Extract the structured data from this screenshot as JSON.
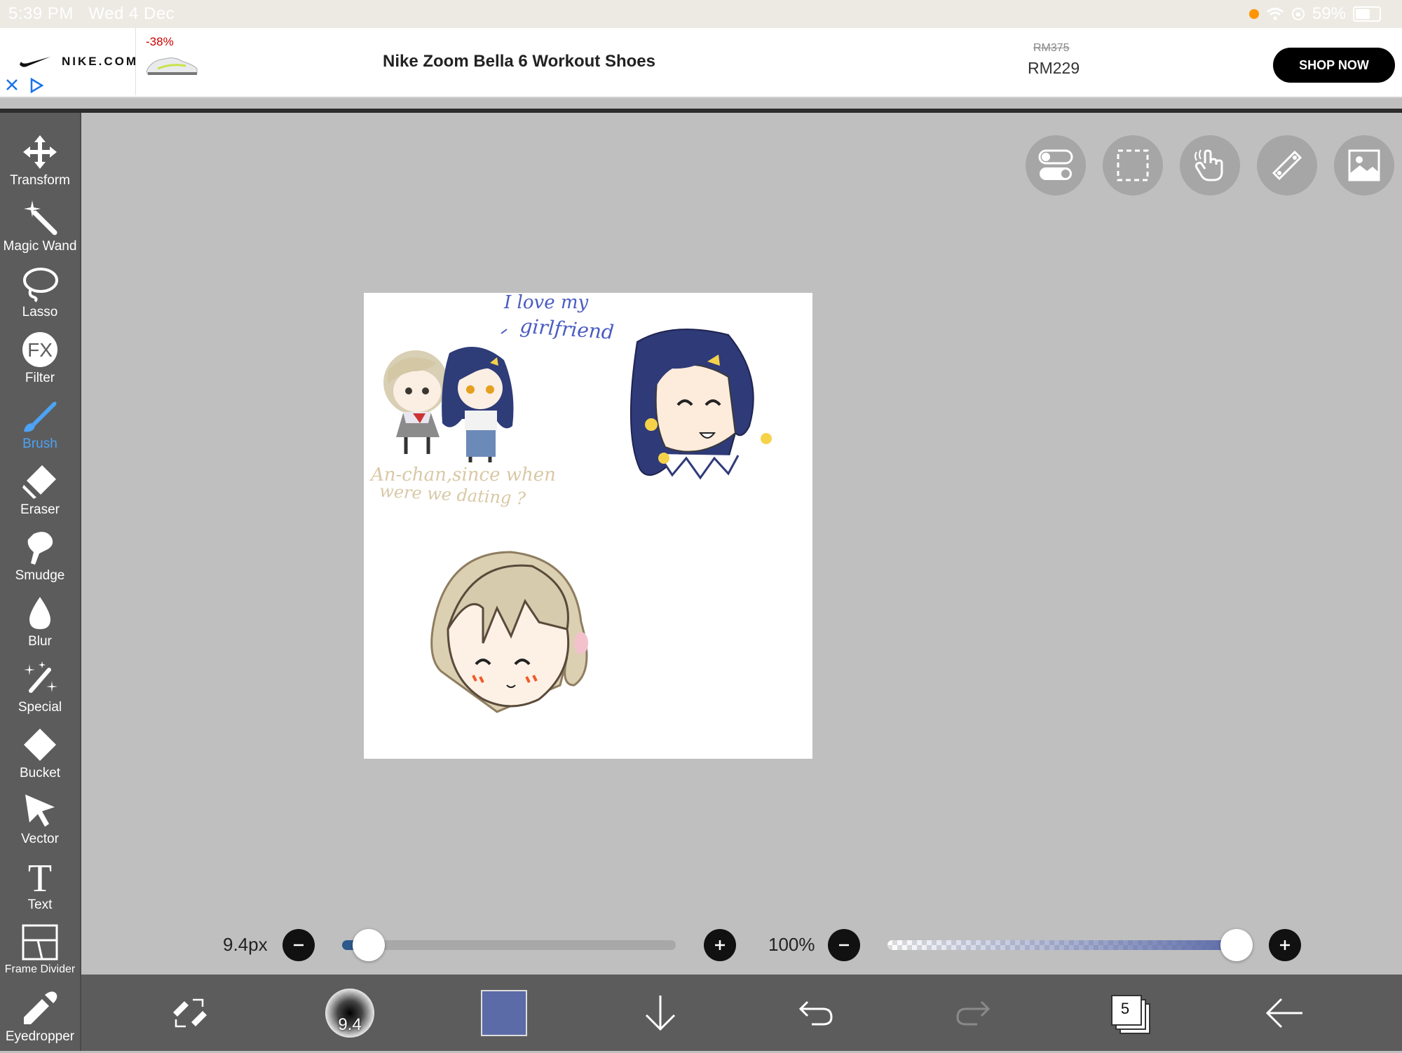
{
  "status_bar": {
    "time": "5:39 PM",
    "date": "Wed 4 Dec",
    "battery": "59%"
  },
  "ad": {
    "domain": "NIKE.COM",
    "discount": "-38%",
    "title": "Nike Zoom Bella 6 Workout Shoes",
    "old_price": "RM375",
    "new_price": "RM229",
    "cta": "SHOP NOW"
  },
  "tools": [
    {
      "label": "Transform",
      "icon": "transform-icon"
    },
    {
      "label": "Magic Wand",
      "icon": "magic-wand-icon"
    },
    {
      "label": "Lasso",
      "icon": "lasso-icon"
    },
    {
      "label": "Filter",
      "icon": "fx-icon",
      "glyph": "FX"
    },
    {
      "label": "Brush",
      "icon": "brush-icon",
      "active": true
    },
    {
      "label": "Eraser",
      "icon": "eraser-icon"
    },
    {
      "label": "Smudge",
      "icon": "smudge-icon"
    },
    {
      "label": "Blur",
      "icon": "droplet-icon"
    },
    {
      "label": "Special",
      "icon": "special-icon"
    },
    {
      "label": "Bucket",
      "icon": "bucket-icon"
    },
    {
      "label": "Vector",
      "icon": "cursor-icon"
    },
    {
      "label": "Text",
      "icon": "text-icon",
      "glyph": "T"
    },
    {
      "label": "Frame Divider",
      "icon": "frame-divider-icon"
    },
    {
      "label": "Eyedropper",
      "icon": "eyedropper-icon"
    }
  ],
  "top_buttons": [
    "toggle-icon",
    "selection-icon",
    "touch-icon",
    "ruler-icon",
    "image-icon"
  ],
  "canvas": {
    "text_love_1": "I love my",
    "text_love_2": "girlfriend",
    "text_question_1": "An-chan,since when",
    "text_question_2": "were we dating ?"
  },
  "brush_settings": {
    "size_label": "9.4px",
    "size_fraction": 0.08,
    "opacity_label": "100%",
    "opacity_fraction": 1.0
  },
  "bottom_toolbar": {
    "brush_size_value": "9.4",
    "current_color": "#5b6ba8",
    "layer_count": "5"
  }
}
